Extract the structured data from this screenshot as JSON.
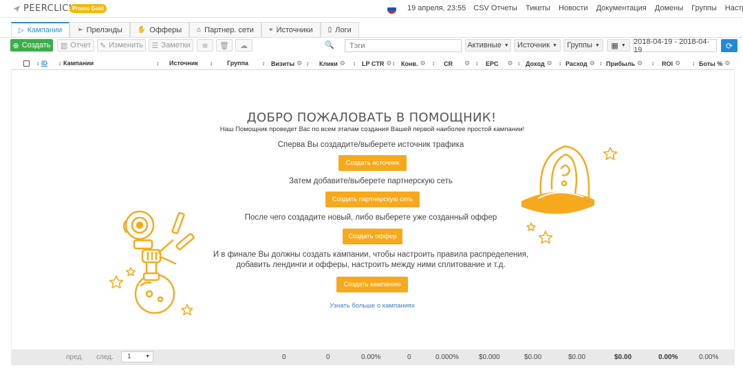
{
  "app": {
    "logo_text": "PEERCLICK",
    "promo_badge": "Promo Gold"
  },
  "topbar": {
    "datetime": "19 апреля, 23:55",
    "nav": [
      "CSV Отчеты",
      "Тикеты",
      "Новости",
      "Документация",
      "Домены",
      "Группы",
      "Настройки"
    ]
  },
  "tabs": [
    {
      "label": "Кампании",
      "icon": "play-icon",
      "active": true
    },
    {
      "label": "Прелэнды",
      "icon": "paper-plane-icon"
    },
    {
      "label": "Офферы",
      "icon": "hand-icon"
    },
    {
      "label": "Партнер. сети",
      "icon": "home-icon"
    },
    {
      "label": "Источники",
      "icon": "crosshair-icon"
    },
    {
      "label": "Логи",
      "icon": "book-icon"
    }
  ],
  "toolbar": {
    "create": "Создать",
    "report": "Отчет",
    "edit": "Изменить",
    "notes": "Заметки",
    "tags_placeholder": "Тэги",
    "active": "Активные",
    "source": "Источник",
    "groups": "Группы",
    "date_range": "2018-04-19 - 2018-04-19"
  },
  "table": {
    "columns": [
      "ID",
      "Кампании",
      "Источник",
      "Группа",
      "Визиты",
      "Клики",
      "LP CTR",
      "Конв.",
      "CR",
      "EPC",
      "Доход",
      "Расход",
      "Прибыль",
      "ROI",
      "Боты %"
    ]
  },
  "welcome": {
    "title": "ДОБРО ПОЖАЛОВАТЬ В ПОМОЩНИК!",
    "subtitle": "Наш Помощник проведет Вас по всем этапам создания Вашей первой наиболее простой кампании!",
    "step1": "Сперва Вы создадите/выберете источник трафика",
    "btn1": "Создать источник",
    "step2": "Затем добавите/выберете партнерскую сеть",
    "btn2": "Создать партнерскую сеть",
    "step3": "После чего создадите новый, либо выберете уже созданный оффер",
    "btn3": "Создать оффер",
    "step4_line1": "И в финале Вы должны создать кампании, чтобы настроить правила распределения,",
    "step4_line2": "добавить лендинги и офферы, настроить между ними сплитование и т.д.",
    "btn4": "Создать кампанию",
    "learn_more": "Узнать больше о кампаниях"
  },
  "footer": {
    "prev": "пред.",
    "next": "след.",
    "page": "1",
    "visits": "0",
    "clicks": "0",
    "lp_ctr": "0.00%",
    "conv": "0",
    "cr": "0.000%",
    "epc": "$0.000",
    "revenue": "$0.00",
    "cost": "$0.00",
    "profit": "$0.00",
    "roi": "0.00%",
    "bots": "0.00%"
  },
  "colors": {
    "accent": "#2a8fce",
    "orange": "#f6a91d",
    "green": "#3cae48"
  }
}
